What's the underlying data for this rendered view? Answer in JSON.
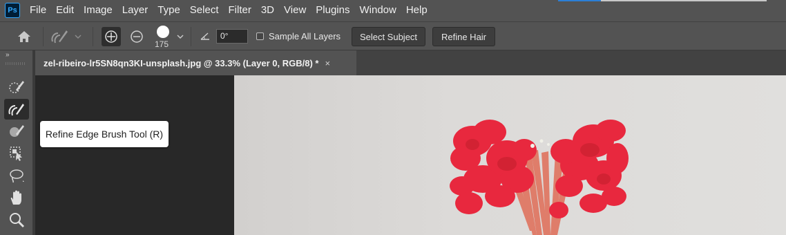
{
  "app": {
    "logo_text": "Ps"
  },
  "menu": {
    "items": [
      "File",
      "Edit",
      "Image",
      "Layer",
      "Type",
      "Select",
      "Filter",
      "3D",
      "View",
      "Plugins",
      "Window",
      "Help"
    ]
  },
  "options_bar": {
    "home_icon": "home-icon",
    "tool_preset_icon": "refine-edge-brush-icon",
    "add_mode_icon": "plus-circle-icon",
    "subtract_mode_icon": "minus-circle-icon",
    "brush_size": "175",
    "angle_value": "0°",
    "sample_all_layers_label": "Sample All Layers",
    "sample_all_layers_checked": false,
    "select_subject_label": "Select Subject",
    "refine_hair_label": "Refine Hair"
  },
  "document": {
    "tab_title": "zel-ribeiro-lr5SN8qn3KI-unsplash.jpg @ 33.3% (Layer 0, RGB/8) *",
    "close_symbol": "×"
  },
  "toolbar": {
    "collapse_symbol": "»",
    "tools": [
      {
        "name": "quick-selection-icon",
        "active": false
      },
      {
        "name": "refine-edge-brush-icon",
        "active": true
      },
      {
        "name": "brush-icon",
        "active": false
      },
      {
        "name": "object-selection-icon",
        "active": false
      },
      {
        "name": "lasso-icon",
        "active": false
      },
      {
        "name": "hand-icon",
        "active": false
      },
      {
        "name": "zoom-icon",
        "active": false
      }
    ]
  },
  "tooltip": {
    "text": "Refine Edge Brush Tool (R)"
  },
  "colors": {
    "ui_background": "#535353",
    "canvas_background": "#282828",
    "photo_background": "#dcdad8",
    "flower_red": "#e8283e",
    "logo_blue": "#31a8ff"
  }
}
